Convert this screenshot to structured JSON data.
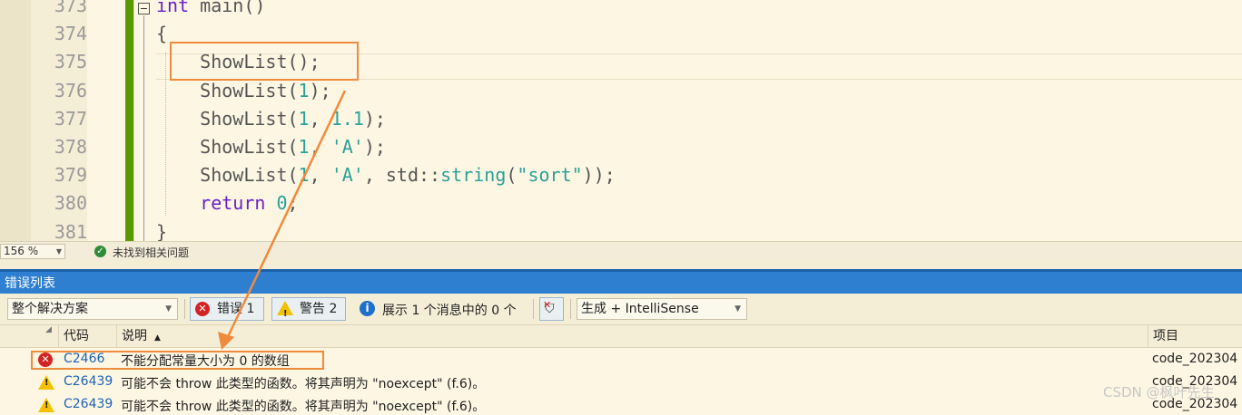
{
  "editor": {
    "line_numbers": [
      "373",
      "374",
      "375",
      "376",
      "377",
      "378",
      "379",
      "380",
      "381"
    ],
    "lines": [
      [
        {
          "t": "int",
          "c": "kw"
        },
        {
          "t": " main()",
          "c": "fn"
        }
      ],
      [
        {
          "t": "{",
          "c": "fn"
        }
      ],
      [
        {
          "t": "    ShowList();",
          "c": "fn"
        }
      ],
      [
        {
          "t": "    ShowList(",
          "c": "fn"
        },
        {
          "t": "1",
          "c": "num"
        },
        {
          "t": ");",
          "c": "fn"
        }
      ],
      [
        {
          "t": "    ShowList(",
          "c": "fn"
        },
        {
          "t": "1",
          "c": "num"
        },
        {
          "t": ", ",
          "c": "fn"
        },
        {
          "t": "1.1",
          "c": "num"
        },
        {
          "t": ");",
          "c": "fn"
        }
      ],
      [
        {
          "t": "    ShowList(",
          "c": "fn"
        },
        {
          "t": "1",
          "c": "num"
        },
        {
          "t": ", ",
          "c": "fn"
        },
        {
          "t": "'A'",
          "c": "str"
        },
        {
          "t": ");",
          "c": "fn"
        }
      ],
      [
        {
          "t": "    ShowList(",
          "c": "fn"
        },
        {
          "t": "1",
          "c": "num"
        },
        {
          "t": ", ",
          "c": "fn"
        },
        {
          "t": "'A'",
          "c": "str"
        },
        {
          "t": ", std::",
          "c": "fn"
        },
        {
          "t": "string",
          "c": "num"
        },
        {
          "t": "(",
          "c": "fn"
        },
        {
          "t": "\"sort\"",
          "c": "str"
        },
        {
          "t": "));",
          "c": "fn"
        }
      ],
      [
        {
          "t": "    ",
          "c": "fn"
        },
        {
          "t": "return",
          "c": "kw"
        },
        {
          "t": " ",
          "c": "fn"
        },
        {
          "t": "0",
          "c": "num"
        },
        {
          "t": ";",
          "c": "fn"
        }
      ],
      [
        {
          "t": "}",
          "c": "fn"
        }
      ]
    ]
  },
  "status": {
    "zoom": "156 %",
    "message": "未找到相关问题"
  },
  "error_list": {
    "title": "错误列表",
    "scope": "整个解决方案",
    "errors_btn": "错误 1",
    "warnings_btn": "警告 2",
    "messages_text": "展示 1 个消息中的 0 个",
    "build_filter": "生成 + IntelliSense",
    "columns": {
      "code": "代码",
      "description": "说明",
      "project": "项目"
    },
    "rows": [
      {
        "severity": "error",
        "code": "C2466",
        "description": "不能分配常量大小为 0 的数组",
        "project": "code_202304"
      },
      {
        "severity": "warning",
        "code": "C26439",
        "description": "可能不会 throw 此类型的函数。将其声明为 \"noexcept\" (f.6)。",
        "project": "code_202304"
      },
      {
        "severity": "warning",
        "code": "C26439",
        "description": "可能不会 throw 此类型的函数。将其声明为 \"noexcept\" (f.6)。",
        "project": "code_202304"
      }
    ]
  },
  "watermark": "CSDN @枫叶先生",
  "colors": {
    "accent_blue": "#2f7fd0",
    "highlight_orange": "#f08a3c",
    "change_bar_green": "#5a9a00"
  }
}
